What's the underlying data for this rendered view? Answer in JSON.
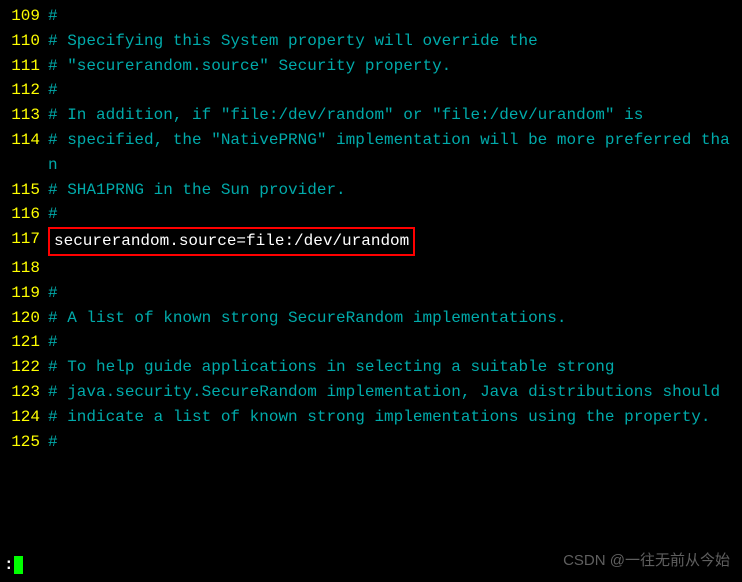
{
  "lines": [
    {
      "num": "109",
      "text": "#"
    },
    {
      "num": "110",
      "text": "# Specifying this System property will override the"
    },
    {
      "num": "111",
      "text": "# \"securerandom.source\" Security property."
    },
    {
      "num": "112",
      "text": "#"
    },
    {
      "num": "113",
      "text": "# In addition, if \"file:/dev/random\" or \"file:/dev/urandom\" is"
    },
    {
      "num": "114",
      "text": "# specified, the \"NativePRNG\" implementation will be more preferred than"
    },
    {
      "num": "115",
      "text": "# SHA1PRNG in the Sun provider."
    },
    {
      "num": "116",
      "text": "#"
    },
    {
      "num": "117",
      "text": "securerandom.source=file:/dev/urandom",
      "highlight": true
    },
    {
      "num": "118",
      "text": ""
    },
    {
      "num": "119",
      "text": "#"
    },
    {
      "num": "120",
      "text": "# A list of known strong SecureRandom implementations."
    },
    {
      "num": "121",
      "text": "#"
    },
    {
      "num": "122",
      "text": "# To help guide applications in selecting a suitable strong"
    },
    {
      "num": "123",
      "text": "# java.security.SecureRandom implementation, Java distributions should"
    },
    {
      "num": "124",
      "text": "# indicate a list of known strong implementations using the property."
    },
    {
      "num": "125",
      "text": "#"
    }
  ],
  "status_prefix": ":",
  "watermark": "CSDN @一往无前从今始"
}
